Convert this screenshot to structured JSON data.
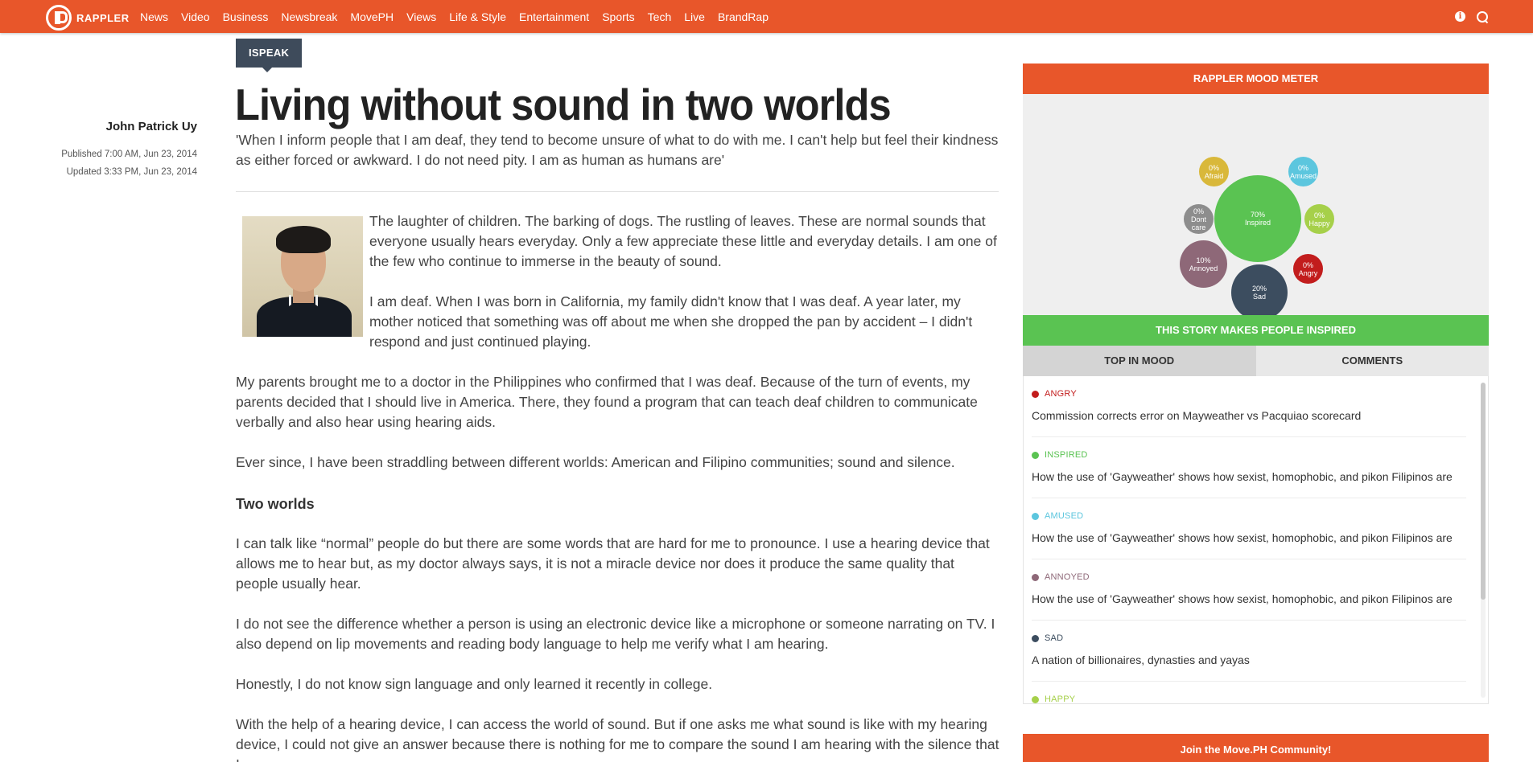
{
  "nav": {
    "brand": "RAPPLER",
    "items": [
      "News",
      "Video",
      "Business",
      "Newsbreak",
      "MovePH",
      "Views",
      "Life & Style",
      "Entertainment",
      "Sports",
      "Tech",
      "Live",
      "BrandRap"
    ],
    "icons": [
      "info-icon",
      "search-icon"
    ],
    "accent_color": "#e8562a"
  },
  "article": {
    "tag": "ISPEAK",
    "headline": "Living without sound in two worlds",
    "author": "John Patrick Uy",
    "published": "Published 7:00 AM, Jun 23, 2014",
    "updated": "Updated 3:33 PM, Jun 23, 2014",
    "dek": "'When I inform people that I am deaf, they tend to become unsure of what to do with me. I can't help but feel their kindness as either forced or awkward. I do not need pity. I am as human as humans are'",
    "p1": "The laughter of children. The barking of dogs. The rustling of leaves. These are normal sounds that everyone usually hears everyday. Only a few appreciate these little and everyday details. I am one of the few who continue to immerse in the beauty of sound.",
    "p2": "I am deaf. When I was born in California, my family didn't know that I was deaf. A year later, my mother noticed that something was off about me when she dropped the pan by accident – I didn't respond and just continued playing.",
    "p3": "My parents brought me to a doctor in the Philippines who confirmed that I was deaf. Because of the turn of events, my parents decided that I should live in America. There, they found a program that can teach deaf children to communicate verbally and also hear using hearing aids.",
    "p4": "Ever since, I have been straddling between different worlds: American and Filipino communities; sound and silence.",
    "subhead": "Two worlds",
    "p5": "I can talk like “normal” people do but there are some words that are hard for me to pronounce. I use a hearing device that allows me to hear but, as my doctor always says, it is not a miracle device nor does it produce the same quality that people usually hear.",
    "p6": "I do not see the difference whether a person is using an electronic device like a microphone or someone narrating on TV. I also depend on lip movements and reading body language to help me verify what I am hearing.",
    "p7": "Honestly, I do not know sign language and only learned it recently in college.",
    "p8": "With the help of a hearing device, I can access the world of sound. But if one asks me what sound is like with my hearing device, I could not give an answer because there is nothing for me to compare the sound I am hearing with the silence that I"
  },
  "mood_meter": {
    "title": "RAPPLER MOOD METER",
    "story_mood": "THIS STORY MAKES PEOPLE INSPIRED",
    "bubbles": [
      {
        "pct": "0%",
        "label": "Afraid",
        "value": 0,
        "color": "#d9b83a"
      },
      {
        "pct": "0%",
        "label": "Amused",
        "value": 0,
        "color": "#5cc6de"
      },
      {
        "pct": "70%",
        "label": "Inspired",
        "value": 70,
        "color": "#5ac352"
      },
      {
        "pct": "0%",
        "label": "Dont care",
        "value": 0,
        "color": "#8d8d8d"
      },
      {
        "pct": "0%",
        "label": "Happy",
        "value": 0,
        "color": "#a6d04a"
      },
      {
        "pct": "10%",
        "label": "Annoyed",
        "value": 10,
        "color": "#8e6878"
      },
      {
        "pct": "0%",
        "label": "Angry",
        "value": 0,
        "color": "#c21d1d"
      },
      {
        "pct": "20%",
        "label": "Sad",
        "value": 20,
        "color": "#3c4d5f"
      }
    ],
    "tabs": [
      "TOP IN MOOD",
      "COMMENTS"
    ],
    "items": [
      {
        "mood": "ANGRY",
        "color": "#c21d1d",
        "title": "Commission corrects error on Mayweather vs Pacquiao scorecard"
      },
      {
        "mood": "INSPIRED",
        "color": "#5ac352",
        "title": "How the use of 'Gayweather' shows how sexist, homophobic, and pikon Filipinos are"
      },
      {
        "mood": "AMUSED",
        "color": "#5cc6de",
        "title": "How the use of 'Gayweather' shows how sexist, homophobic, and pikon Filipinos are"
      },
      {
        "mood": "ANNOYED",
        "color": "#8e6878",
        "title": "How the use of 'Gayweather' shows how sexist, homophobic, and pikon Filipinos are"
      },
      {
        "mood": "SAD",
        "color": "#3c4d5f",
        "title": "A nation of billionaires, dynasties and yayas"
      },
      {
        "mood": "HAPPY",
        "color": "#a6d04a",
        "title": ""
      }
    ]
  },
  "join_banner": "Join the Move.PH Community!"
}
